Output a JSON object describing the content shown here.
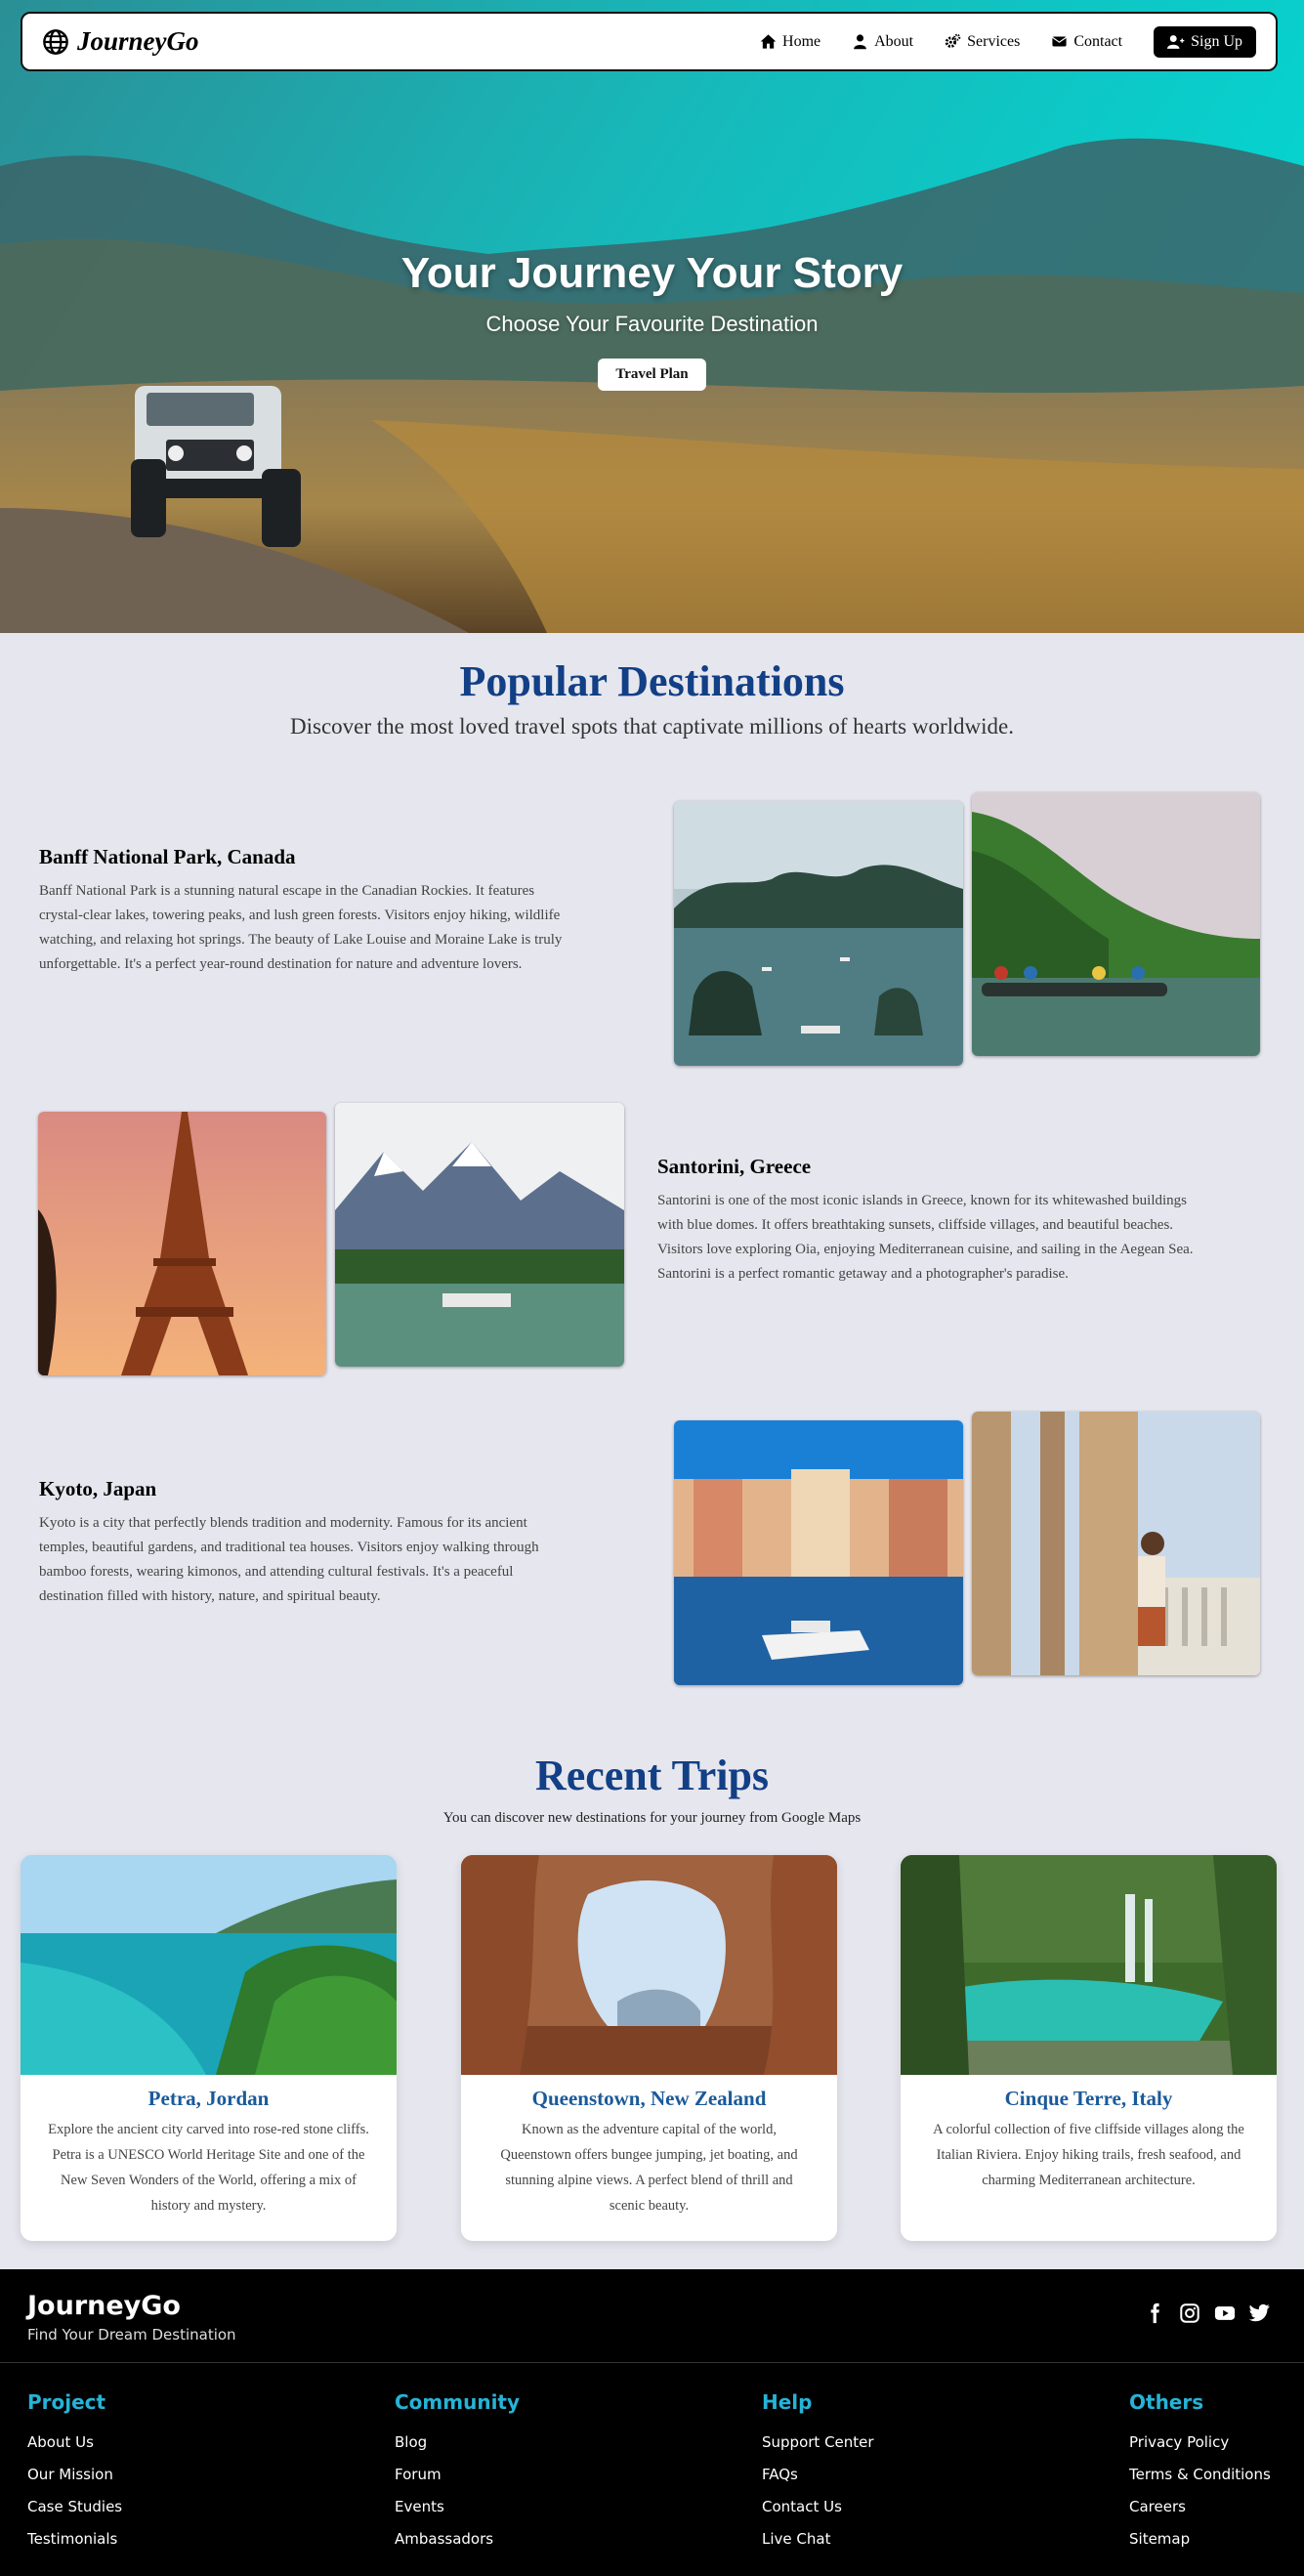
{
  "nav": {
    "brand": "JourneyGo",
    "links": [
      "Home",
      "About",
      "Services",
      "Contact"
    ],
    "signup": "Sign Up"
  },
  "hero": {
    "title": "Your Journey Your Story",
    "subtitle": "Choose Your Favourite Destination",
    "button": "Travel Plan"
  },
  "popular": {
    "title": "Popular Destinations",
    "subtitle": "Discover the most loved travel spots that captivate millions of hearts worldwide.",
    "items": [
      {
        "name": "Banff National Park, Canada",
        "text": "Banff National Park is a stunning natural escape in the Canadian Rockies. It features crystal-clear lakes, towering peaks, and lush green forests. Visitors enjoy hiking, wildlife watching, and relaxing hot springs. The beauty of Lake Louise and Moraine Lake is truly unforgettable. It's a perfect year-round destination for nature and adventure lovers."
      },
      {
        "name": "Santorini, Greece",
        "text": "Santorini is one of the most iconic islands in Greece, known for its whitewashed buildings with blue domes. It offers breathtaking sunsets, cliffside villages, and beautiful beaches. Visitors love exploring Oia, enjoying Mediterranean cuisine, and sailing in the Aegean Sea. Santorini is a perfect romantic getaway and a photographer's paradise."
      },
      {
        "name": "Kyoto, Japan",
        "text": "Kyoto is a city that perfectly blends tradition and modernity. Famous for its ancient temples, beautiful gardens, and traditional tea houses. Visitors enjoy walking through bamboo forests, wearing kimonos, and attending cultural festivals. It's a peaceful destination filled with history, nature, and spiritual beauty."
      }
    ]
  },
  "recent": {
    "title": "Recent Trips",
    "subtitle": "You can discover new destinations for your journey from Google Maps",
    "cards": [
      {
        "name": "Petra, Jordan",
        "text": "Explore the ancient city carved into rose-red stone cliffs. Petra is a UNESCO World Heritage Site and one of the New Seven Wonders of the World, offering a mix of history and mystery."
      },
      {
        "name": "Queenstown, New Zealand",
        "text": "Known as the adventure capital of the world, Queenstown offers bungee jumping, jet boating, and stunning alpine views. A perfect blend of thrill and scenic beauty."
      },
      {
        "name": "Cinque Terre, Italy",
        "text": "A colorful collection of five cliffside villages along the Italian Riviera. Enjoy hiking trails, fresh seafood, and charming Mediterranean architecture."
      }
    ]
  },
  "footer": {
    "brand": "JourneyGo",
    "tagline": "Find Your Dream Destination",
    "socials": [
      "facebook-icon",
      "instagram-icon",
      "youtube-icon",
      "twitter-icon"
    ],
    "columns": [
      {
        "title": "Project",
        "links": [
          "About Us",
          "Our Mission",
          "Case Studies",
          "Testimonials"
        ]
      },
      {
        "title": "Community",
        "links": [
          "Blog",
          "Forum",
          "Events",
          "Ambassadors"
        ]
      },
      {
        "title": "Help",
        "links": [
          "Support Center",
          "FAQs",
          "Contact Us",
          "Live Chat"
        ]
      },
      {
        "title": "Others",
        "links": [
          "Privacy Policy",
          "Terms & Conditions",
          "Careers",
          "Sitemap"
        ]
      }
    ]
  },
  "colors": {
    "heading_blue": "#123f85",
    "card_title_blue": "#1a5a9a",
    "footer_accent": "#26b3d6",
    "page_bg": "#e6e6ee"
  }
}
